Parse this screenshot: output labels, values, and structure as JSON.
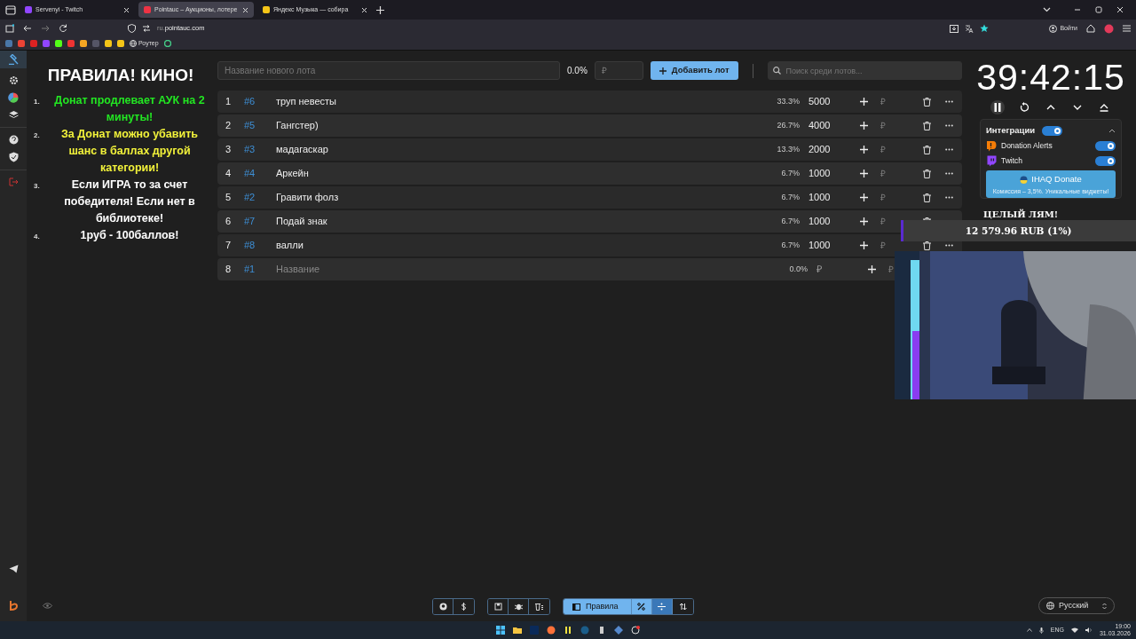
{
  "browser": {
    "tabs": [
      {
        "title": "Servenyi - Twitch",
        "selected": false
      },
      {
        "title": "Pointauc – Аукционы, лотере",
        "selected": true
      },
      {
        "title": "Яндекс Музыка — собира",
        "selected": false
      }
    ],
    "url_prefix": "ru.",
    "url_domain": "pointauc.com",
    "sign_in": "Войти",
    "bookmark_label": "Роутер"
  },
  "rules": {
    "title": "ПРАВИЛА! КИНО!",
    "items": [
      {
        "number": "1.",
        "text": "Донат продлевает АУК на 2 минуты!",
        "color": "#22e622"
      },
      {
        "number": "2.",
        "text": "За Донат можно убавить шанс в баллах другой категории!",
        "color": "#f2f23a"
      },
      {
        "number": "3.",
        "text": "Если ИГРА то за счет победителя! Если нет в библиотеке!",
        "color": "#ffffff"
      },
      {
        "number": "4.",
        "text": "1руб - 100баллов!",
        "color": "#ffffff"
      }
    ]
  },
  "new_lot": {
    "name_placeholder": "Название нового лота",
    "percent": "0.0%",
    "amount_placeholder": "₽",
    "add_button": "Добавить лот",
    "search_placeholder": "Поиск среди лотов..."
  },
  "lots": [
    {
      "index": "1",
      "id": "#6",
      "name": "труп невесты",
      "percent": "33.3%",
      "amount": "5000"
    },
    {
      "index": "2",
      "id": "#5",
      "name": "Гангстер)",
      "percent": "26.7%",
      "amount": "4000"
    },
    {
      "index": "3",
      "id": "#3",
      "name": "мадагаскар",
      "percent": "13.3%",
      "amount": "2000"
    },
    {
      "index": "4",
      "id": "#4",
      "name": "Аркейн",
      "percent": "6.7%",
      "amount": "1000"
    },
    {
      "index": "5",
      "id": "#2",
      "name": "Гравити фолз",
      "percent": "6.7%",
      "amount": "1000"
    },
    {
      "index": "6",
      "id": "#7",
      "name": "Подай знак",
      "percent": "6.7%",
      "amount": "1000"
    },
    {
      "index": "7",
      "id": "#8",
      "name": "валли",
      "percent": "6.7%",
      "amount": "1000"
    },
    {
      "index": "8",
      "id": "#1",
      "name_placeholder": "Название",
      "percent": "0.0%",
      "amount_placeholder": "₽"
    }
  ],
  "timer": "39:42:15",
  "integrations": {
    "title": "Интеграции",
    "on": true,
    "items": [
      {
        "name": "Donation Alerts",
        "kind": "da",
        "on": true
      },
      {
        "name": "Twitch",
        "kind": "twitch",
        "on": true
      }
    ],
    "promo_title": "IHAQ Donate",
    "promo_subtitle": "Комиссия – 3,5%. Уникальные виджеты!"
  },
  "stream_overlay": {
    "goal_title": "ЦЕЛЫЙ ЛЯМ!",
    "goal_amount": "12 579.96 RUB (1%)",
    "level": 0.01
  },
  "footer": {
    "rules_button": {
      "label": "Правила",
      "selected": true
    },
    "language": "Русский"
  },
  "taskbar": {
    "language": "ENG",
    "time": "19:00",
    "date": "31.03.2026"
  }
}
